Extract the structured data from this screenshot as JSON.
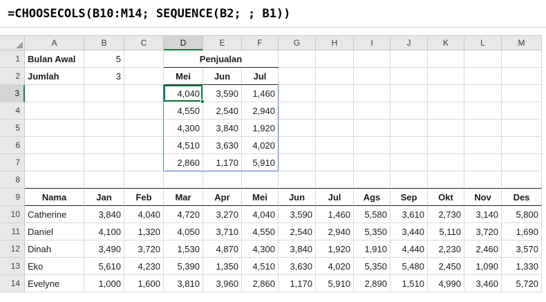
{
  "formula_bar": {
    "formula": "=CHOOSECOLS(B10:M14; SEQUENCE(B2; ; B1))"
  },
  "grid": {
    "column_headers": [
      "A",
      "B",
      "C",
      "D",
      "E",
      "F",
      "G",
      "H",
      "I",
      "J",
      "K",
      "L",
      "M"
    ],
    "rows": [
      [
        "Bulan Awal",
        "5",
        "",
        "Penjualan",
        "",
        "",
        "",
        "",
        "",
        "",
        "",
        "",
        ""
      ],
      [
        "Jumlah",
        "3",
        "",
        "Mei",
        "Jun",
        "Jul",
        "",
        "",
        "",
        "",
        "",
        "",
        ""
      ],
      [
        "",
        "",
        "",
        "4,040",
        "3,590",
        "1,460",
        "",
        "",
        "",
        "",
        "",
        "",
        ""
      ],
      [
        "",
        "",
        "",
        "4,550",
        "2,540",
        "2,940",
        "",
        "",
        "",
        "",
        "",
        "",
        ""
      ],
      [
        "",
        "",
        "",
        "4,300",
        "3,840",
        "1,920",
        "",
        "",
        "",
        "",
        "",
        "",
        ""
      ],
      [
        "",
        "",
        "",
        "4,510",
        "3,630",
        "4,020",
        "",
        "",
        "",
        "",
        "",
        "",
        ""
      ],
      [
        "",
        "",
        "",
        "2,860",
        "1,170",
        "5,910",
        "",
        "",
        "",
        "",
        "",
        "",
        ""
      ],
      [
        "",
        "",
        "",
        "",
        "",
        "",
        "",
        "",
        "",
        "",
        "",
        "",
        ""
      ],
      [
        "Nama",
        "Jan",
        "Feb",
        "Mar",
        "Apr",
        "Mei",
        "Jun",
        "Jul",
        "Ags",
        "Sep",
        "Okt",
        "Nov",
        "Des"
      ],
      [
        "Catherine",
        "3,840",
        "4,040",
        "4,720",
        "3,270",
        "4,040",
        "3,590",
        "1,460",
        "5,580",
        "3,610",
        "2,730",
        "3,140",
        "5,800"
      ],
      [
        "Daniel",
        "4,100",
        "1,320",
        "4,050",
        "3,710",
        "4,550",
        "2,540",
        "2,940",
        "5,350",
        "3,440",
        "5,110",
        "3,720",
        "1,690"
      ],
      [
        "Dinah",
        "3,490",
        "3,720",
        "1,530",
        "4,870",
        "4,300",
        "3,840",
        "1,920",
        "1,910",
        "4,440",
        "2,230",
        "2,460",
        "3,570"
      ],
      [
        "Eko",
        "5,610",
        "4,230",
        "5,390",
        "1,350",
        "4,510",
        "3,630",
        "4,020",
        "5,350",
        "5,480",
        "2,450",
        "1,090",
        "1,330"
      ],
      [
        "Evelyne",
        "1,000",
        "1,600",
        "3,810",
        "3,960",
        "2,860",
        "1,170",
        "5,910",
        "2,890",
        "1,510",
        "4,990",
        "3,460",
        "5,720"
      ]
    ],
    "merged": {
      "row_index": 0,
      "col_index": 3,
      "span": 3
    },
    "selection": {
      "active_cell": "D3",
      "active_col_index": 3,
      "active_row_index": 2,
      "spill_range": "D3:F7",
      "spill": {
        "c1": 3,
        "r1": 2,
        "c2": 5,
        "r2": 6
      }
    },
    "table_header_row_index": 8
  },
  "colors": {
    "selection_green": "#107C41",
    "spill_border_blue": "#4472C4",
    "header_bg": "#E8E8E8",
    "selected_header_bg": "#D4D4D4",
    "grid_line": "#D9D9D9",
    "dark_border": "#1F1F1F"
  }
}
